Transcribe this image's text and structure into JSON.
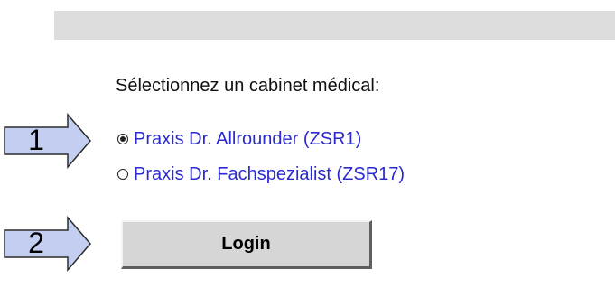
{
  "prompt": "Sélectionnez un cabinet médical:",
  "options": [
    {
      "label": "Praxis Dr. Allrounder (ZSR1)",
      "selected": true
    },
    {
      "label": "Praxis Dr. Fachspezialist (ZSR17)",
      "selected": false
    }
  ],
  "steps": [
    "1",
    "2"
  ],
  "login_label": "Login",
  "colors": {
    "option_text": "#2a2ad0",
    "arrow_fill": "#c4cef0",
    "top_bar": "#dcdcdc",
    "button_face": "#d6d6d6"
  },
  "icons": [
    "step-arrow-icon",
    "radio-checked-icon",
    "radio-unchecked-icon"
  ]
}
